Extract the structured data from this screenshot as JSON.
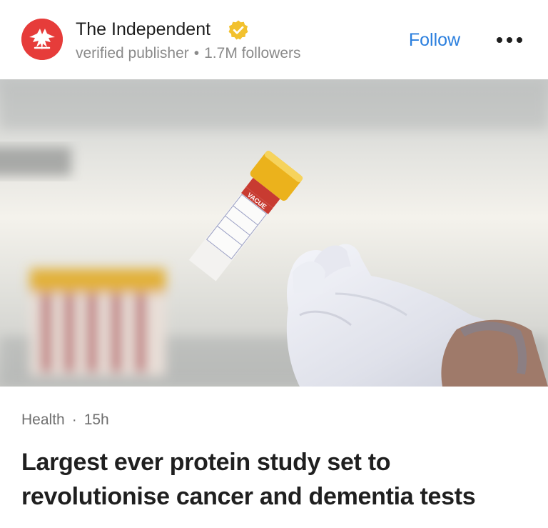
{
  "publisher": {
    "name": "The Independent",
    "status": "verified publisher",
    "followers": "1.7M followers",
    "separator": "•",
    "brand_color": "#e63c3a",
    "badge_color": "#f2c12e",
    "logo_icon": "eagle-icon"
  },
  "actions": {
    "follow_label": "Follow",
    "follow_color": "#2b7fde",
    "more_icon": "more-horizontal-icon"
  },
  "hero_image": {
    "depicts": "gloved-hand-holding-blood-sample-tube",
    "tube_label": "VACUE"
  },
  "article": {
    "category": "Health",
    "separator": "·",
    "age": "15h",
    "headline": "Largest ever protein study set to revolutionise cancer and dementia tests"
  }
}
